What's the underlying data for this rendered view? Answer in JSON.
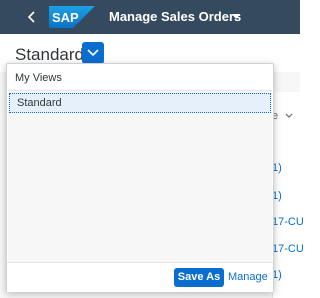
{
  "shell": {
    "logo_text": "SAP",
    "app_title": "Manage Sales Orders",
    "colors": {
      "bar": "#354a5f",
      "logo": "#1a8bd8"
    }
  },
  "header": {
    "variant_name": "Standard*"
  },
  "popover": {
    "section_label": "My Views",
    "items": [
      {
        "label": "Standard",
        "selected": true
      }
    ],
    "save_as_label": "Save As",
    "manage_label": "Manage"
  },
  "background_table": {
    "column_header": "e",
    "cells": [
      "1)",
      "1)",
      "17-CU",
      "17-CU",
      "1)"
    ]
  },
  "accent_color": "#0a6ed1"
}
